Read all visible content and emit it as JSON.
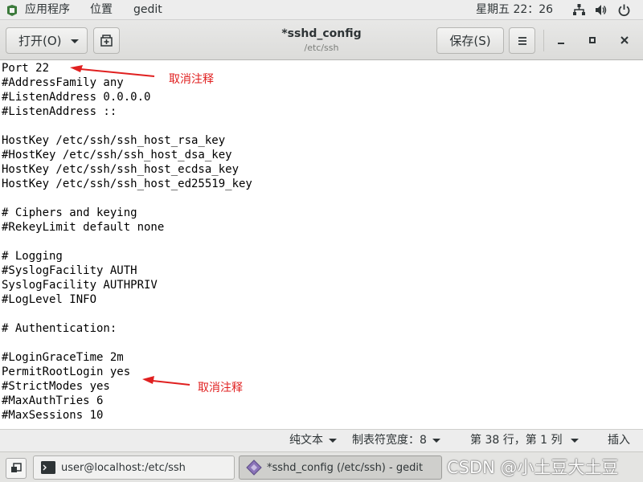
{
  "topbar": {
    "apps_menu": "应用程序",
    "places_menu": "位置",
    "app_name": "gedit",
    "clock": "星期五 22：26",
    "icons": [
      "network-icon",
      "volume-icon",
      "power-icon"
    ]
  },
  "headerbar": {
    "open_label": "打开(O)",
    "title": "*sshd_config",
    "path": "/etc/ssh",
    "save_label": "保存(S)",
    "icons": [
      "new-tab-icon",
      "hamburger-menu-icon",
      "minimize-icon",
      "maximize-icon",
      "close-icon"
    ]
  },
  "editor": {
    "lines": [
      "Port 22",
      "#AddressFamily any",
      "#ListenAddress 0.0.0.0",
      "#ListenAddress ::",
      "",
      "HostKey /etc/ssh/ssh_host_rsa_key",
      "#HostKey /etc/ssh/ssh_host_dsa_key",
      "HostKey /etc/ssh/ssh_host_ecdsa_key",
      "HostKey /etc/ssh/ssh_host_ed25519_key",
      "",
      "# Ciphers and keying",
      "#RekeyLimit default none",
      "",
      "# Logging",
      "#SyslogFacility AUTH",
      "SyslogFacility AUTHPRIV",
      "#LogLevel INFO",
      "",
      "# Authentication:",
      "",
      "#LoginGraceTime 2m",
      "PermitRootLogin yes",
      "#StrictModes yes",
      "#MaxAuthTries 6",
      "#MaxSessions 10"
    ],
    "annotations": [
      "取消注释",
      "取消注释"
    ],
    "annotation_color": "#e02020"
  },
  "statusbar": {
    "language": "纯文本",
    "tab_width": "制表符宽度：8",
    "position": "第 38 行，第 1 列",
    "insert_mode": "插入"
  },
  "taskbar": {
    "terminal_task": "user@localhost:/etc/ssh",
    "gedit_task": "*sshd_config (/etc/ssh) - gedit",
    "watermark": "CSDN @小土豆大土豆"
  }
}
